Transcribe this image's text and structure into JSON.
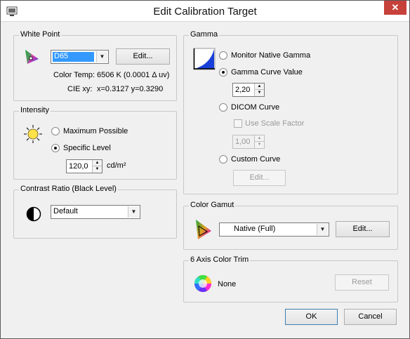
{
  "window": {
    "title": "Edit Calibration Target",
    "close_label": "✕"
  },
  "white_point": {
    "group_title": "White Point",
    "selected": "D65",
    "edit_label": "Edit...",
    "color_temp_label": "Color Temp:",
    "color_temp_value": "6506 K (0.0001 Δ uv)",
    "cie_label": "CIE xy:",
    "cie_value": "x=0.3127 y=0.3290"
  },
  "intensity": {
    "group_title": "Intensity",
    "option_max": "Maximum Possible",
    "option_specific": "Specific Level",
    "selected": "specific",
    "level_value": "120,0",
    "unit": "cd/m²"
  },
  "contrast": {
    "group_title": "Contrast Ratio (Black Level)",
    "selected": "Default"
  },
  "gamma": {
    "group_title": "Gamma",
    "option_native": "Monitor Native Gamma",
    "option_curve": "Gamma Curve Value",
    "curve_value": "2,20",
    "option_dicom": "DICOM Curve",
    "use_scale_label": "Use Scale Factor",
    "scale_value": "1,00",
    "option_custom": "Custom Curve",
    "edit_label": "Edit...",
    "selected": "curve"
  },
  "gamut": {
    "group_title": "Color Gamut",
    "selected": "Native (Full)",
    "edit_label": "Edit..."
  },
  "trim": {
    "group_title": "6 Axis Color Trim",
    "value": "None",
    "reset_label": "Reset"
  },
  "footer": {
    "ok_label": "OK",
    "cancel_label": "Cancel"
  }
}
